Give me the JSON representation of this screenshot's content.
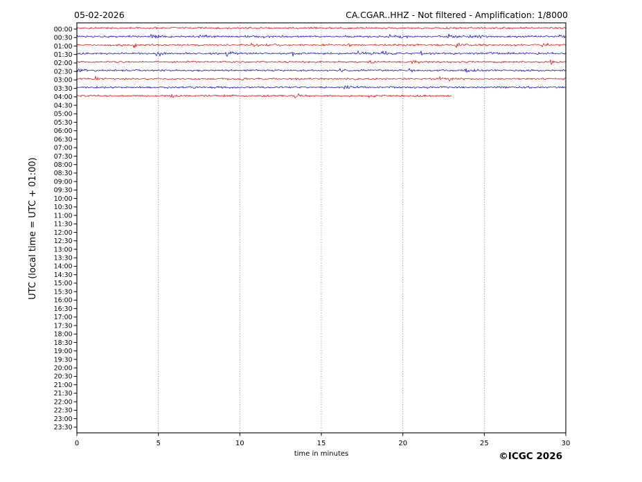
{
  "header": {
    "date": "05-02-2026",
    "title": "CA.CGAR..HHZ - Not filtered - Amplification: 1/8000"
  },
  "footer": {
    "xlabel": "time in minutes",
    "copyright": "©ICGC 2026"
  },
  "chart_data": {
    "type": "line",
    "subtype": "helicorder-seismogram",
    "title": "CA.CGAR..HHZ - Not filtered - Amplification: 1/8000",
    "date": "05-02-2026",
    "station": "CA.CGAR..HHZ",
    "filter_status": "Not filtered",
    "amplification": "1/8000",
    "xlabel": "time in minutes",
    "ylabel": "UTC (local time = UTC + 01:00)",
    "xlim": [
      0,
      30
    ],
    "x_ticks": [
      0,
      5,
      10,
      15,
      20,
      25,
      30
    ],
    "y_ticks": [
      "00:00",
      "00:30",
      "01:00",
      "01:30",
      "02:00",
      "02:30",
      "03:00",
      "03:30",
      "04:00",
      "04:30",
      "05:00",
      "05:30",
      "06:00",
      "06:30",
      "07:00",
      "07:30",
      "08:00",
      "08:30",
      "09:00",
      "09:30",
      "10:00",
      "10:30",
      "11:00",
      "11:30",
      "12:00",
      "12:30",
      "13:00",
      "13:30",
      "14:00",
      "14:30",
      "15:00",
      "15:30",
      "16:00",
      "16:30",
      "17:00",
      "17:30",
      "18:00",
      "18:30",
      "19:00",
      "19:30",
      "20:00",
      "20:30",
      "21:00",
      "21:30",
      "22:00",
      "22:30",
      "23:00",
      "23:30"
    ],
    "grid": {
      "vertical_dotted_at_minutes": [
        5,
        10,
        15,
        20,
        25
      ]
    },
    "legend": {
      "visible": false
    },
    "colors": {
      "red_trace": "#e60000",
      "blue_trace": "#0000dd",
      "axis": "#000000",
      "background": "#ffffff"
    },
    "traces": [
      {
        "row": "00:00",
        "color": "red",
        "start_min": 0,
        "end_min": 30
      },
      {
        "row": "00:30",
        "color": "blue",
        "start_min": 0,
        "end_min": 30
      },
      {
        "row": "01:00",
        "color": "red",
        "start_min": 0,
        "end_min": 30
      },
      {
        "row": "01:30",
        "color": "blue",
        "start_min": 0,
        "end_min": 30
      },
      {
        "row": "02:00",
        "color": "red",
        "start_min": 0,
        "end_min": 30
      },
      {
        "row": "02:30",
        "color": "blue",
        "start_min": 0,
        "end_min": 30
      },
      {
        "row": "03:00",
        "color": "red",
        "start_min": 0,
        "end_min": 30
      },
      {
        "row": "03:30",
        "color": "blue",
        "start_min": 0,
        "end_min": 30
      },
      {
        "row": "04:00",
        "color": "red",
        "start_min": 0,
        "end_min": 23
      }
    ],
    "copyright": "©ICGC 2026"
  }
}
